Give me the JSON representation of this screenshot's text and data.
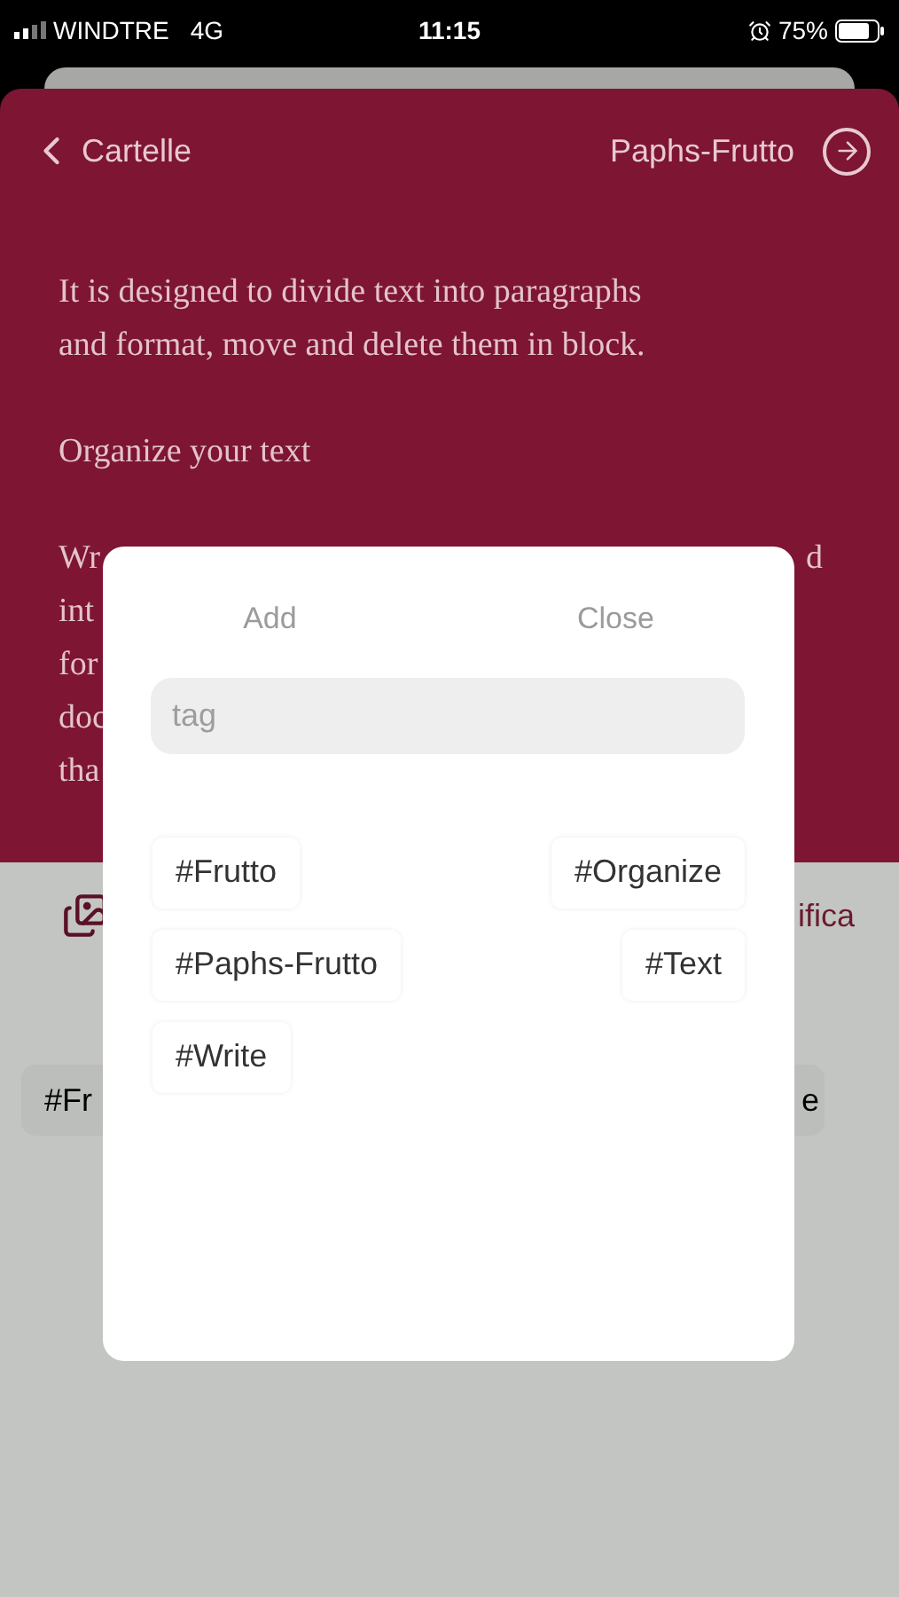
{
  "status_bar": {
    "carrier": "WINDTRE",
    "network": "4G",
    "time": "11:15",
    "battery": "75%"
  },
  "nav": {
    "back": "Cartelle",
    "title": "Paphs-Frutto"
  },
  "text_paragraphs": [
    [
      "It is designed to divide text into paragraphs",
      "and format, move and delete them in block."
    ],
    [
      "Organize your text"
    ]
  ],
  "covered_lines": [
    {
      "left": "Wr",
      "right": "d"
    },
    {
      "left": "int"
    },
    {
      "left": "for"
    },
    {
      "left": "doc"
    },
    {
      "left": "tha"
    }
  ],
  "toolbar": {
    "label": "ifica"
  },
  "tag_chip": {
    "left": "#Fr",
    "right": "e"
  },
  "modal": {
    "add": "Add",
    "close": "Close",
    "search": {
      "placeholder": "tag"
    },
    "tags": [
      "#Frutto",
      "#Organize",
      "#Paphs-Frutto",
      "#Text",
      "#Write"
    ]
  }
}
